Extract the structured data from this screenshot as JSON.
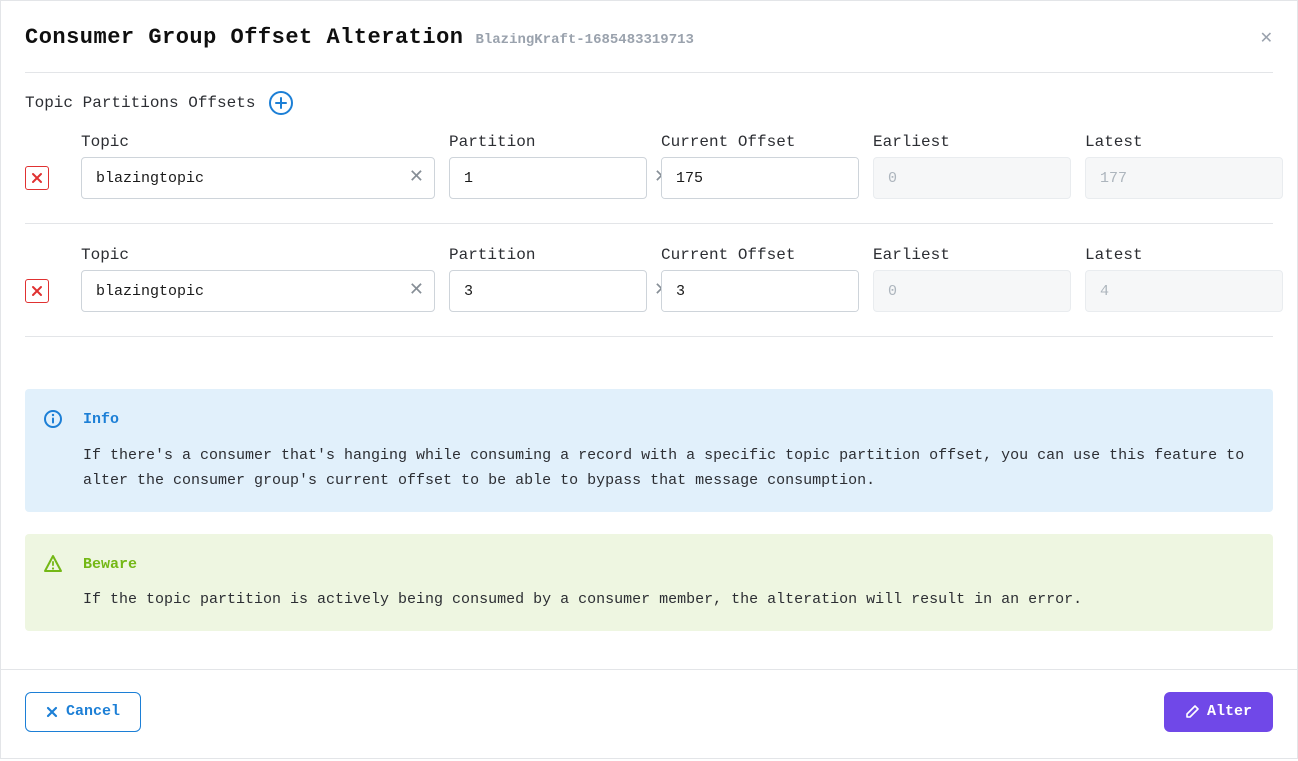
{
  "header": {
    "title": "Consumer Group Offset Alteration",
    "group_name": "BlazingKraft-1685483319713"
  },
  "section": {
    "title": "Topic Partitions Offsets"
  },
  "labels": {
    "topic": "Topic",
    "partition": "Partition",
    "current_offset": "Current Offset",
    "earliest": "Earliest",
    "latest": "Latest"
  },
  "rows": [
    {
      "topic": "blazingtopic",
      "partition": "1",
      "offset": "175",
      "earliest": "0",
      "latest": "177"
    },
    {
      "topic": "blazingtopic",
      "partition": "3",
      "offset": "3",
      "earliest": "0",
      "latest": "4"
    }
  ],
  "alerts": {
    "info_title": "Info",
    "info_text": "If there's a consumer that's hanging while consuming a record with a specific topic partition offset, you can use this feature to alter the consumer group's current offset to be able to bypass that message consumption.",
    "warn_title": "Beware",
    "warn_text": "If the topic partition is actively being consumed by a consumer member, the alteration will result in an error."
  },
  "footer": {
    "cancel": "Cancel",
    "alter": "Alter"
  }
}
